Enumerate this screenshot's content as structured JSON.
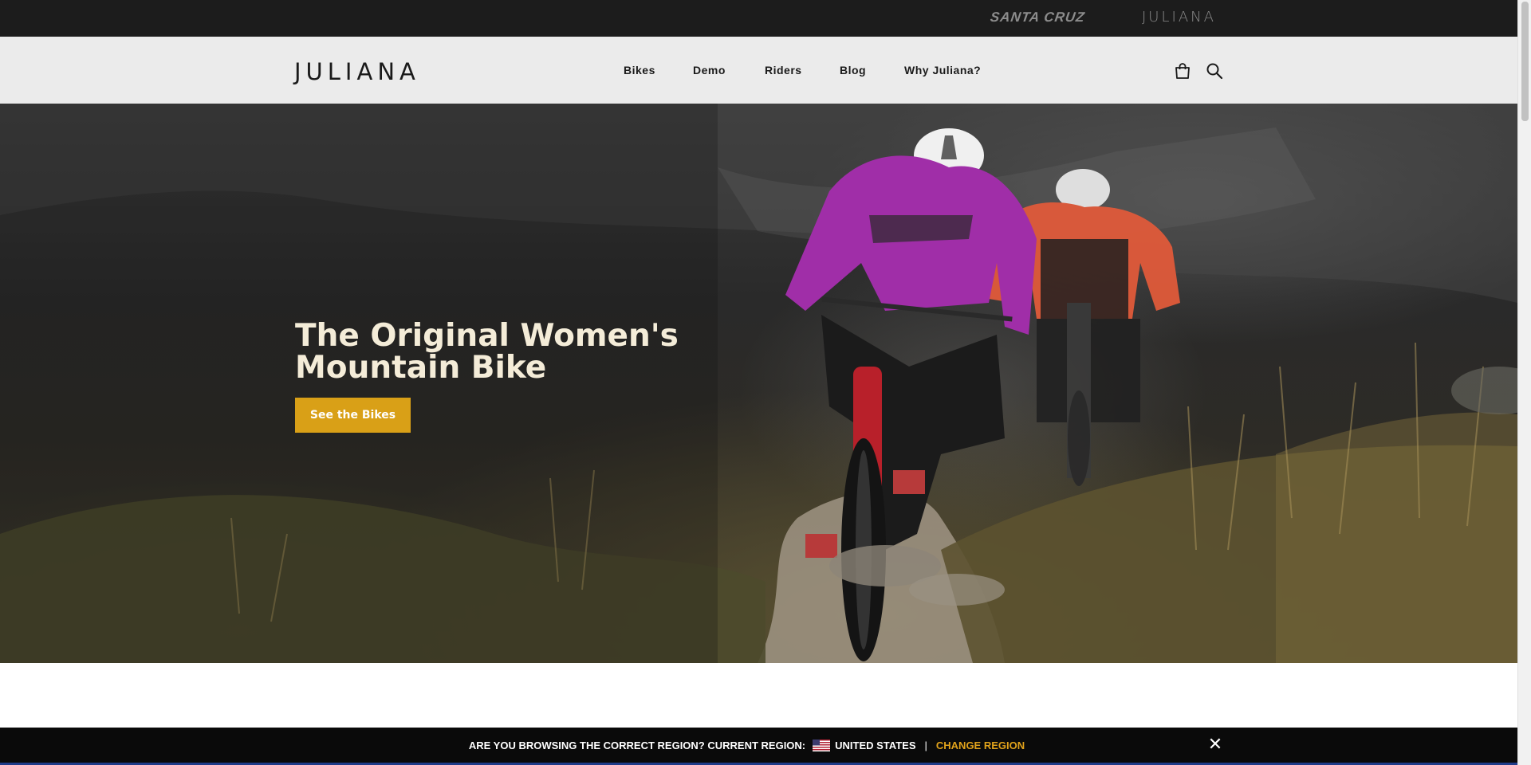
{
  "brand_bar": {
    "santa_cruz": "SANTA CRUZ",
    "juliana": "JULIANA"
  },
  "nav": {
    "logo": "JULIANA",
    "links": [
      "Bikes",
      "Demo",
      "Riders",
      "Blog",
      "Why Juliana?"
    ],
    "cart_icon": "shopping-bag-icon",
    "search_icon": "search-icon"
  },
  "hero": {
    "title": "The Original Women's Mountain Bike",
    "cta_label": "See the Bikes",
    "image_alt": "Two women riding mountain bikes on a rocky trail through heather"
  },
  "region_banner": {
    "prompt": "ARE YOU BROWSING THE CORRECT REGION? CURRENT REGION:",
    "flag_icon": "us-flag-icon",
    "current_region": "UNITED STATES",
    "separator": "|",
    "change_label": "CHANGE REGION",
    "close_label": "✕"
  },
  "colors": {
    "topbar": "#1c1c1c",
    "navbar": "#ebebeb",
    "cta": "#d9a017",
    "hero_text": "#f4ecd8",
    "change_region": "#e0a21b"
  }
}
